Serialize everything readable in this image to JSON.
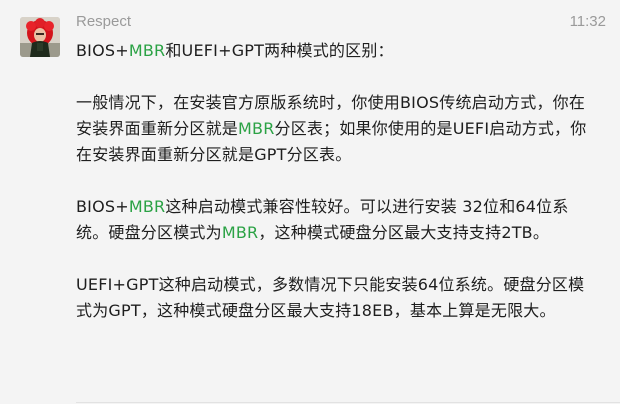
{
  "message": {
    "sender": "Respect",
    "time": "11:32",
    "paragraphs": [
      [
        {
          "t": "BIOS+"
        },
        {
          "t": "MBR",
          "hl": true
        },
        {
          "t": "和UEFI+GPT两种模式的区别："
        }
      ],
      [
        {
          "t": "一般情况下，在安装官方原版系统时，你使用BIOS传统启动方式，你在安装界面重新分区就是"
        },
        {
          "t": "MBR",
          "hl": true
        },
        {
          "t": "分区表；如果你使用的是UEFI启动方式，你在安装界面重新分区就是GPT分区表。"
        }
      ],
      [
        {
          "t": "BIOS+"
        },
        {
          "t": "MBR",
          "hl": true
        },
        {
          "t": "这种启动模式兼容性较好。可以进行安装 32位和64位系统。硬盘分区模式为"
        },
        {
          "t": "MBR",
          "hl": true
        },
        {
          "t": "，这种模式硬盘分区最大支持支持2TB。"
        }
      ],
      [
        {
          "t": "UEFI+GPT这种启动模式，多数情况下只能安装64位系统。硬盘分区模式为GPT，这种模式硬盘分区最大支持18EB，基本上算是无限大。"
        }
      ]
    ]
  },
  "colors": {
    "highlight": "#2ba245",
    "meta_text": "#9a9a9a",
    "body_text": "#1e1e1e",
    "background": "#f4f4f4"
  },
  "avatar": {
    "icon": "avatar-photo-red-hood"
  }
}
